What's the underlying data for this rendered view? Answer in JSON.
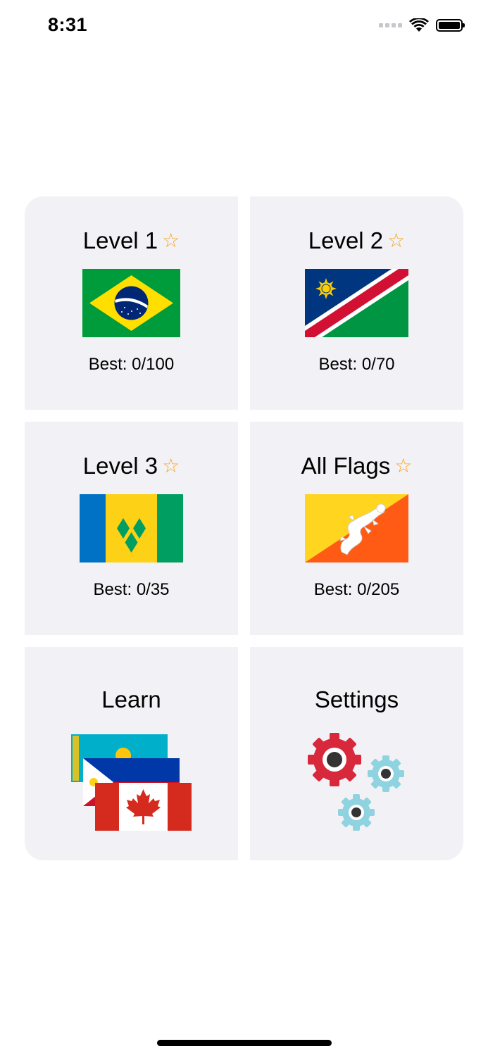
{
  "status_bar": {
    "time": "8:31"
  },
  "levels": [
    {
      "title": "Level 1",
      "best": "Best: 0/100",
      "flag": "brazil-flag"
    },
    {
      "title": "Level 2",
      "best": "Best: 0/70",
      "flag": "namibia-flag"
    },
    {
      "title": "Level 3",
      "best": "Best: 0/35",
      "flag": "saint-vincent-flag"
    },
    {
      "title": "All Flags",
      "best": "Best: 0/205",
      "flag": "bhutan-flag"
    }
  ],
  "learn": {
    "title": "Learn",
    "icon": "stacked-flags-icon"
  },
  "settings": {
    "title": "Settings",
    "icon": "gears-icon"
  },
  "colors": {
    "tile_bg": "#f2f2f6",
    "star": "#f5a623"
  }
}
